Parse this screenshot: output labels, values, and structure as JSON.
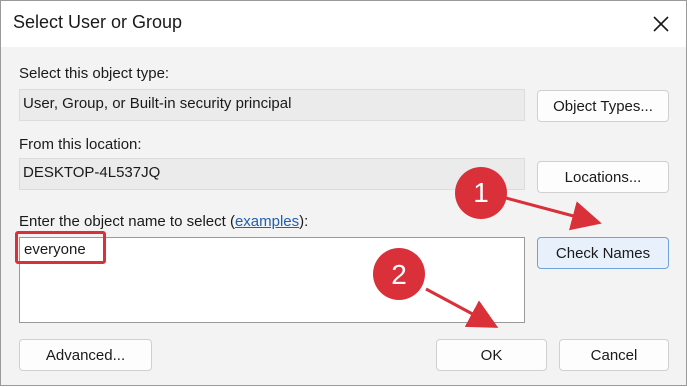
{
  "window": {
    "title": "Select User or Group"
  },
  "object_type": {
    "label": "Select this object type:",
    "value": "User, Group, or Built-in security principal",
    "button": "Object Types..."
  },
  "location": {
    "label": "From this location:",
    "value": "DESKTOP-4L537JQ",
    "button": "Locations..."
  },
  "object_name": {
    "label_before": "Enter the object name to select (",
    "link": "examples",
    "label_after": "):",
    "value": "everyone",
    "check_button": "Check Names"
  },
  "footer": {
    "advanced_button": "Advanced...",
    "ok_button": "OK",
    "cancel_button": "Cancel"
  },
  "annotations": {
    "step1": "1",
    "step2": "2",
    "color": "#d9303a"
  }
}
